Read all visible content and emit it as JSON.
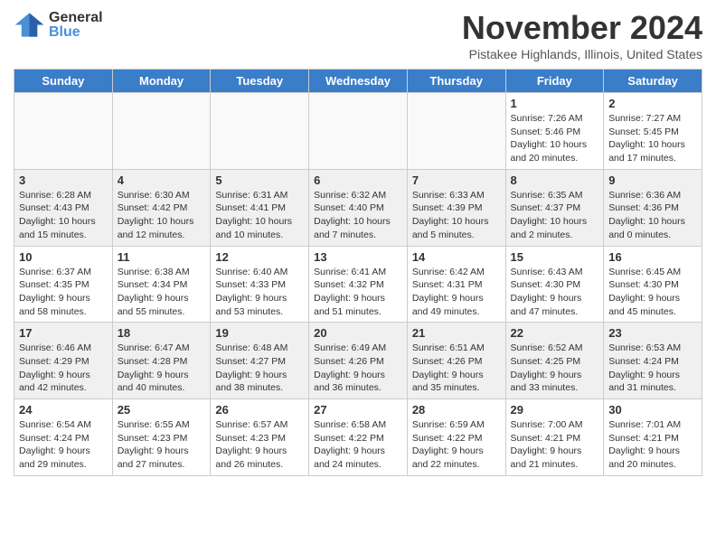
{
  "header": {
    "logo_general": "General",
    "logo_blue": "Blue",
    "month_title": "November 2024",
    "location": "Pistakee Highlands, Illinois, United States"
  },
  "weekdays": [
    "Sunday",
    "Monday",
    "Tuesday",
    "Wednesday",
    "Thursday",
    "Friday",
    "Saturday"
  ],
  "weeks": [
    [
      {
        "day": "",
        "info": ""
      },
      {
        "day": "",
        "info": ""
      },
      {
        "day": "",
        "info": ""
      },
      {
        "day": "",
        "info": ""
      },
      {
        "day": "",
        "info": ""
      },
      {
        "day": "1",
        "info": "Sunrise: 7:26 AM\nSunset: 5:46 PM\nDaylight: 10 hours\nand 20 minutes."
      },
      {
        "day": "2",
        "info": "Sunrise: 7:27 AM\nSunset: 5:45 PM\nDaylight: 10 hours\nand 17 minutes."
      }
    ],
    [
      {
        "day": "3",
        "info": "Sunrise: 6:28 AM\nSunset: 4:43 PM\nDaylight: 10 hours\nand 15 minutes."
      },
      {
        "day": "4",
        "info": "Sunrise: 6:30 AM\nSunset: 4:42 PM\nDaylight: 10 hours\nand 12 minutes."
      },
      {
        "day": "5",
        "info": "Sunrise: 6:31 AM\nSunset: 4:41 PM\nDaylight: 10 hours\nand 10 minutes."
      },
      {
        "day": "6",
        "info": "Sunrise: 6:32 AM\nSunset: 4:40 PM\nDaylight: 10 hours\nand 7 minutes."
      },
      {
        "day": "7",
        "info": "Sunrise: 6:33 AM\nSunset: 4:39 PM\nDaylight: 10 hours\nand 5 minutes."
      },
      {
        "day": "8",
        "info": "Sunrise: 6:35 AM\nSunset: 4:37 PM\nDaylight: 10 hours\nand 2 minutes."
      },
      {
        "day": "9",
        "info": "Sunrise: 6:36 AM\nSunset: 4:36 PM\nDaylight: 10 hours\nand 0 minutes."
      }
    ],
    [
      {
        "day": "10",
        "info": "Sunrise: 6:37 AM\nSunset: 4:35 PM\nDaylight: 9 hours\nand 58 minutes."
      },
      {
        "day": "11",
        "info": "Sunrise: 6:38 AM\nSunset: 4:34 PM\nDaylight: 9 hours\nand 55 minutes."
      },
      {
        "day": "12",
        "info": "Sunrise: 6:40 AM\nSunset: 4:33 PM\nDaylight: 9 hours\nand 53 minutes."
      },
      {
        "day": "13",
        "info": "Sunrise: 6:41 AM\nSunset: 4:32 PM\nDaylight: 9 hours\nand 51 minutes."
      },
      {
        "day": "14",
        "info": "Sunrise: 6:42 AM\nSunset: 4:31 PM\nDaylight: 9 hours\nand 49 minutes."
      },
      {
        "day": "15",
        "info": "Sunrise: 6:43 AM\nSunset: 4:30 PM\nDaylight: 9 hours\nand 47 minutes."
      },
      {
        "day": "16",
        "info": "Sunrise: 6:45 AM\nSunset: 4:30 PM\nDaylight: 9 hours\nand 45 minutes."
      }
    ],
    [
      {
        "day": "17",
        "info": "Sunrise: 6:46 AM\nSunset: 4:29 PM\nDaylight: 9 hours\nand 42 minutes."
      },
      {
        "day": "18",
        "info": "Sunrise: 6:47 AM\nSunset: 4:28 PM\nDaylight: 9 hours\nand 40 minutes."
      },
      {
        "day": "19",
        "info": "Sunrise: 6:48 AM\nSunset: 4:27 PM\nDaylight: 9 hours\nand 38 minutes."
      },
      {
        "day": "20",
        "info": "Sunrise: 6:49 AM\nSunset: 4:26 PM\nDaylight: 9 hours\nand 36 minutes."
      },
      {
        "day": "21",
        "info": "Sunrise: 6:51 AM\nSunset: 4:26 PM\nDaylight: 9 hours\nand 35 minutes."
      },
      {
        "day": "22",
        "info": "Sunrise: 6:52 AM\nSunset: 4:25 PM\nDaylight: 9 hours\nand 33 minutes."
      },
      {
        "day": "23",
        "info": "Sunrise: 6:53 AM\nSunset: 4:24 PM\nDaylight: 9 hours\nand 31 minutes."
      }
    ],
    [
      {
        "day": "24",
        "info": "Sunrise: 6:54 AM\nSunset: 4:24 PM\nDaylight: 9 hours\nand 29 minutes."
      },
      {
        "day": "25",
        "info": "Sunrise: 6:55 AM\nSunset: 4:23 PM\nDaylight: 9 hours\nand 27 minutes."
      },
      {
        "day": "26",
        "info": "Sunrise: 6:57 AM\nSunset: 4:23 PM\nDaylight: 9 hours\nand 26 minutes."
      },
      {
        "day": "27",
        "info": "Sunrise: 6:58 AM\nSunset: 4:22 PM\nDaylight: 9 hours\nand 24 minutes."
      },
      {
        "day": "28",
        "info": "Sunrise: 6:59 AM\nSunset: 4:22 PM\nDaylight: 9 hours\nand 22 minutes."
      },
      {
        "day": "29",
        "info": "Sunrise: 7:00 AM\nSunset: 4:21 PM\nDaylight: 9 hours\nand 21 minutes."
      },
      {
        "day": "30",
        "info": "Sunrise: 7:01 AM\nSunset: 4:21 PM\nDaylight: 9 hours\nand 20 minutes."
      }
    ]
  ]
}
